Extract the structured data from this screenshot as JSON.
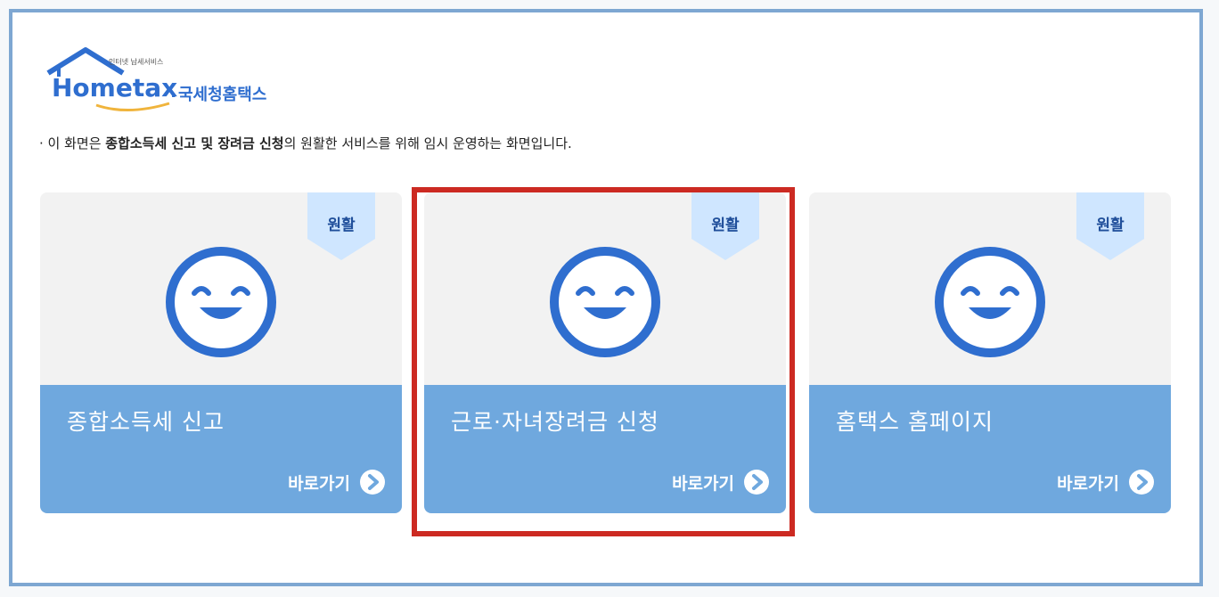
{
  "brand": {
    "logo_small": "인터넷 납세서비스",
    "logo_main": "Hometax",
    "logo_suffix": "국세청홈택스"
  },
  "notice": {
    "prefix": "· 이 화면은 ",
    "bold1": "종합소득세 신고",
    "mid": " 및 ",
    "bold2": "장려금 신청",
    "suffix": "의 원활한 서비스를 위해 임시 운영하는 화면입니다."
  },
  "cards": [
    {
      "status": "원활",
      "title": "종합소득세 신고",
      "link": "바로가기"
    },
    {
      "status": "원활",
      "title": "근로·자녀장려금 신청",
      "link": "바로가기"
    },
    {
      "status": "원활",
      "title": "홈택스 홈페이지",
      "link": "바로가기"
    }
  ],
  "colors": {
    "frame_border": "#7ea7d2",
    "card_bottom": "#6fa8de",
    "ribbon": "#cfe6ff",
    "face": "#2f6ecf",
    "highlight": "#cc2a22"
  },
  "icons": {
    "face": "smiley-face-icon",
    "arrow": "chevron-right-circle-icon",
    "house": "house-icon"
  }
}
